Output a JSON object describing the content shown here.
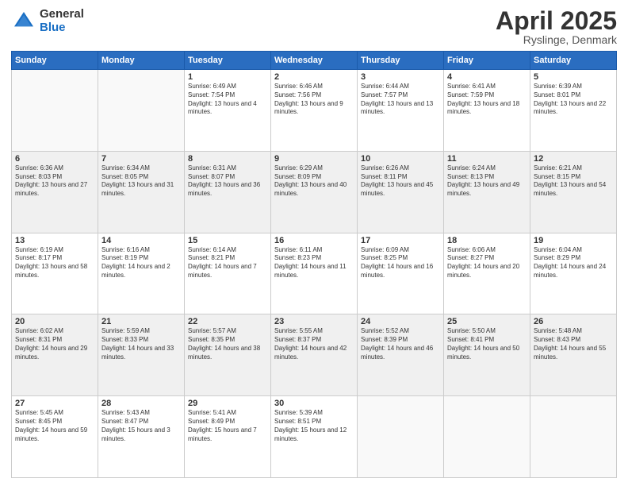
{
  "header": {
    "logo_general": "General",
    "logo_blue": "Blue",
    "title": "April 2025",
    "location": "Ryslinge, Denmark"
  },
  "days_of_week": [
    "Sunday",
    "Monday",
    "Tuesday",
    "Wednesday",
    "Thursday",
    "Friday",
    "Saturday"
  ],
  "weeks": [
    [
      {
        "day": "",
        "info": ""
      },
      {
        "day": "",
        "info": ""
      },
      {
        "day": "1",
        "info": "Sunrise: 6:49 AM\nSunset: 7:54 PM\nDaylight: 13 hours and 4 minutes."
      },
      {
        "day": "2",
        "info": "Sunrise: 6:46 AM\nSunset: 7:56 PM\nDaylight: 13 hours and 9 minutes."
      },
      {
        "day": "3",
        "info": "Sunrise: 6:44 AM\nSunset: 7:57 PM\nDaylight: 13 hours and 13 minutes."
      },
      {
        "day": "4",
        "info": "Sunrise: 6:41 AM\nSunset: 7:59 PM\nDaylight: 13 hours and 18 minutes."
      },
      {
        "day": "5",
        "info": "Sunrise: 6:39 AM\nSunset: 8:01 PM\nDaylight: 13 hours and 22 minutes."
      }
    ],
    [
      {
        "day": "6",
        "info": "Sunrise: 6:36 AM\nSunset: 8:03 PM\nDaylight: 13 hours and 27 minutes."
      },
      {
        "day": "7",
        "info": "Sunrise: 6:34 AM\nSunset: 8:05 PM\nDaylight: 13 hours and 31 minutes."
      },
      {
        "day": "8",
        "info": "Sunrise: 6:31 AM\nSunset: 8:07 PM\nDaylight: 13 hours and 36 minutes."
      },
      {
        "day": "9",
        "info": "Sunrise: 6:29 AM\nSunset: 8:09 PM\nDaylight: 13 hours and 40 minutes."
      },
      {
        "day": "10",
        "info": "Sunrise: 6:26 AM\nSunset: 8:11 PM\nDaylight: 13 hours and 45 minutes."
      },
      {
        "day": "11",
        "info": "Sunrise: 6:24 AM\nSunset: 8:13 PM\nDaylight: 13 hours and 49 minutes."
      },
      {
        "day": "12",
        "info": "Sunrise: 6:21 AM\nSunset: 8:15 PM\nDaylight: 13 hours and 54 minutes."
      }
    ],
    [
      {
        "day": "13",
        "info": "Sunrise: 6:19 AM\nSunset: 8:17 PM\nDaylight: 13 hours and 58 minutes."
      },
      {
        "day": "14",
        "info": "Sunrise: 6:16 AM\nSunset: 8:19 PM\nDaylight: 14 hours and 2 minutes."
      },
      {
        "day": "15",
        "info": "Sunrise: 6:14 AM\nSunset: 8:21 PM\nDaylight: 14 hours and 7 minutes."
      },
      {
        "day": "16",
        "info": "Sunrise: 6:11 AM\nSunset: 8:23 PM\nDaylight: 14 hours and 11 minutes."
      },
      {
        "day": "17",
        "info": "Sunrise: 6:09 AM\nSunset: 8:25 PM\nDaylight: 14 hours and 16 minutes."
      },
      {
        "day": "18",
        "info": "Sunrise: 6:06 AM\nSunset: 8:27 PM\nDaylight: 14 hours and 20 minutes."
      },
      {
        "day": "19",
        "info": "Sunrise: 6:04 AM\nSunset: 8:29 PM\nDaylight: 14 hours and 24 minutes."
      }
    ],
    [
      {
        "day": "20",
        "info": "Sunrise: 6:02 AM\nSunset: 8:31 PM\nDaylight: 14 hours and 29 minutes."
      },
      {
        "day": "21",
        "info": "Sunrise: 5:59 AM\nSunset: 8:33 PM\nDaylight: 14 hours and 33 minutes."
      },
      {
        "day": "22",
        "info": "Sunrise: 5:57 AM\nSunset: 8:35 PM\nDaylight: 14 hours and 38 minutes."
      },
      {
        "day": "23",
        "info": "Sunrise: 5:55 AM\nSunset: 8:37 PM\nDaylight: 14 hours and 42 minutes."
      },
      {
        "day": "24",
        "info": "Sunrise: 5:52 AM\nSunset: 8:39 PM\nDaylight: 14 hours and 46 minutes."
      },
      {
        "day": "25",
        "info": "Sunrise: 5:50 AM\nSunset: 8:41 PM\nDaylight: 14 hours and 50 minutes."
      },
      {
        "day": "26",
        "info": "Sunrise: 5:48 AM\nSunset: 8:43 PM\nDaylight: 14 hours and 55 minutes."
      }
    ],
    [
      {
        "day": "27",
        "info": "Sunrise: 5:45 AM\nSunset: 8:45 PM\nDaylight: 14 hours and 59 minutes."
      },
      {
        "day": "28",
        "info": "Sunrise: 5:43 AM\nSunset: 8:47 PM\nDaylight: 15 hours and 3 minutes."
      },
      {
        "day": "29",
        "info": "Sunrise: 5:41 AM\nSunset: 8:49 PM\nDaylight: 15 hours and 7 minutes."
      },
      {
        "day": "30",
        "info": "Sunrise: 5:39 AM\nSunset: 8:51 PM\nDaylight: 15 hours and 12 minutes."
      },
      {
        "day": "",
        "info": ""
      },
      {
        "day": "",
        "info": ""
      },
      {
        "day": "",
        "info": ""
      }
    ]
  ]
}
